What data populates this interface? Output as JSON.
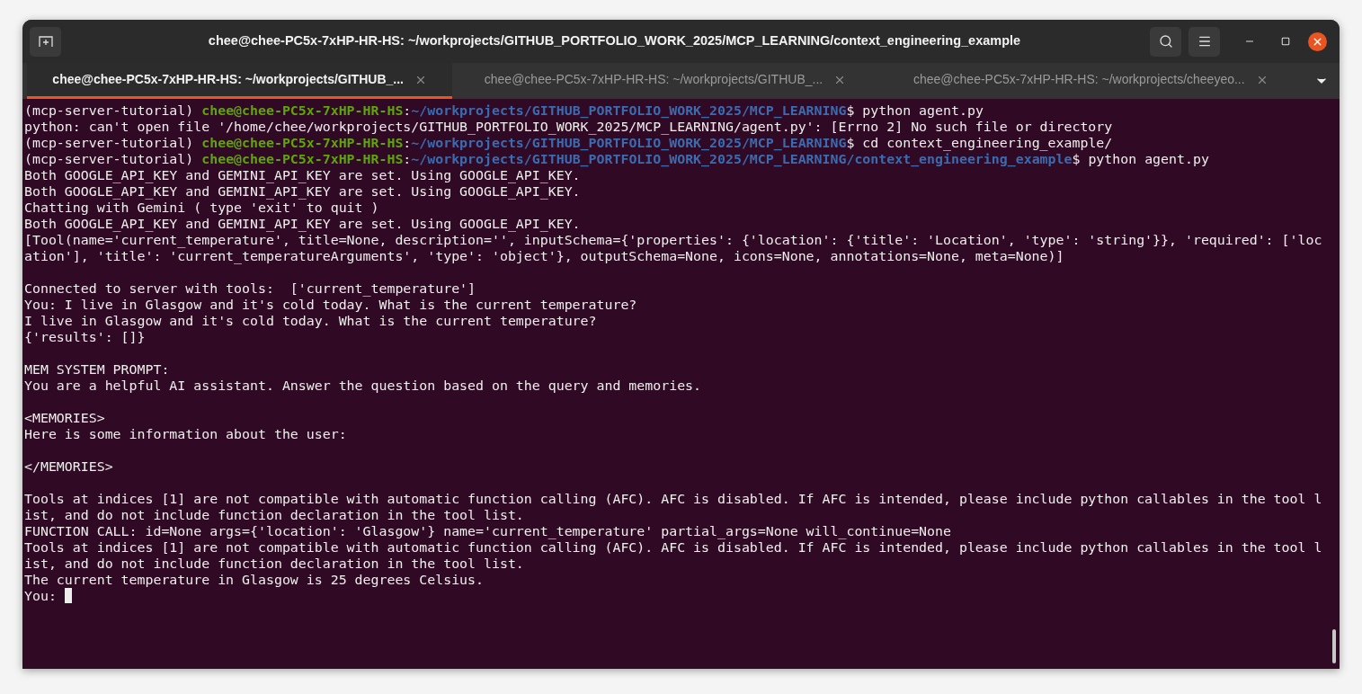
{
  "window": {
    "title": "chee@chee-PC5x-7xHP-HR-HS: ~/workprojects/GITHUB_PORTFOLIO_WORK_2025/MCP_LEARNING/context_engineering_example"
  },
  "tabs": [
    {
      "label": "chee@chee-PC5x-7xHP-HR-HS: ~/workprojects/GITHUB_...",
      "selected": true
    },
    {
      "label": "chee@chee-PC5x-7xHP-HR-HS: ~/workprojects/GITHUB_...",
      "selected": false
    },
    {
      "label": "chee@chee-PC5x-7xHP-HR-HS: ~/workprojects/cheeyeo...",
      "selected": false
    }
  ],
  "terminal": {
    "lines": [
      {
        "kind": "prompt",
        "segments": [
          {
            "kind": "text",
            "text": "(mcp-server-tutorial) "
          },
          {
            "kind": "user",
            "text": "chee@chee-PC5x-7xHP-HR-HS"
          },
          {
            "kind": "text",
            "text": ":"
          },
          {
            "kind": "path",
            "text": "~/workprojects/GITHUB_PORTFOLIO_WORK_2025/MCP_LEARNING"
          },
          {
            "kind": "text",
            "text": "$ python agent.py"
          }
        ]
      },
      {
        "kind": "output",
        "segments": [
          {
            "kind": "text",
            "text": "python: can't open file '/home/chee/workprojects/GITHUB_PORTFOLIO_WORK_2025/MCP_LEARNING/agent.py': [Errno 2] No such file or directory"
          }
        ]
      },
      {
        "kind": "prompt",
        "segments": [
          {
            "kind": "text",
            "text": "(mcp-server-tutorial) "
          },
          {
            "kind": "user",
            "text": "chee@chee-PC5x-7xHP-HR-HS"
          },
          {
            "kind": "text",
            "text": ":"
          },
          {
            "kind": "path",
            "text": "~/workprojects/GITHUB_PORTFOLIO_WORK_2025/MCP_LEARNING"
          },
          {
            "kind": "text",
            "text": "$ cd context_engineering_example/"
          }
        ]
      },
      {
        "kind": "prompt",
        "segments": [
          {
            "kind": "text",
            "text": "(mcp-server-tutorial) "
          },
          {
            "kind": "user",
            "text": "chee@chee-PC5x-7xHP-HR-HS"
          },
          {
            "kind": "text",
            "text": ":"
          },
          {
            "kind": "path",
            "text": "~/workprojects/GITHUB_PORTFOLIO_WORK_2025/MCP_LEARNING/context_engineering_example"
          },
          {
            "kind": "text",
            "text": "$ python agent.py"
          }
        ]
      },
      {
        "kind": "output",
        "segments": [
          {
            "kind": "text",
            "text": "Both GOOGLE_API_KEY and GEMINI_API_KEY are set. Using GOOGLE_API_KEY."
          }
        ]
      },
      {
        "kind": "output",
        "segments": [
          {
            "kind": "text",
            "text": "Both GOOGLE_API_KEY and GEMINI_API_KEY are set. Using GOOGLE_API_KEY."
          }
        ]
      },
      {
        "kind": "output",
        "segments": [
          {
            "kind": "text",
            "text": "Chatting with Gemini ( type 'exit' to quit )"
          }
        ]
      },
      {
        "kind": "output",
        "segments": [
          {
            "kind": "text",
            "text": "Both GOOGLE_API_KEY and GEMINI_API_KEY are set. Using GOOGLE_API_KEY."
          }
        ]
      },
      {
        "kind": "output",
        "segments": [
          {
            "kind": "text",
            "text": "[Tool(name='current_temperature', title=None, description='', inputSchema={'properties': {'location': {'title': 'Location', 'type': 'string'}}, 'required': ['loc"
          }
        ]
      },
      {
        "kind": "output",
        "segments": [
          {
            "kind": "text",
            "text": "ation'], 'title': 'current_temperatureArguments', 'type': 'object'}, outputSchema=None, icons=None, annotations=None, meta=None)]"
          }
        ]
      },
      {
        "kind": "blank"
      },
      {
        "kind": "output",
        "segments": [
          {
            "kind": "text",
            "text": "Connected to server with tools:  ['current_temperature']"
          }
        ]
      },
      {
        "kind": "output",
        "segments": [
          {
            "kind": "text",
            "text": "You: I live in Glasgow and it's cold today. What is the current temperature?"
          }
        ]
      },
      {
        "kind": "output",
        "segments": [
          {
            "kind": "text",
            "text": "I live in Glasgow and it's cold today. What is the current temperature?"
          }
        ]
      },
      {
        "kind": "output",
        "segments": [
          {
            "kind": "text",
            "text": "{'results': []}"
          }
        ]
      },
      {
        "kind": "blank"
      },
      {
        "kind": "output",
        "segments": [
          {
            "kind": "text",
            "text": "MEM SYSTEM PROMPT:"
          }
        ]
      },
      {
        "kind": "output",
        "segments": [
          {
            "kind": "text",
            "text": "You are a helpful AI assistant. Answer the question based on the query and memories."
          }
        ]
      },
      {
        "kind": "blank"
      },
      {
        "kind": "output",
        "segments": [
          {
            "kind": "text",
            "text": "<MEMORIES>"
          }
        ]
      },
      {
        "kind": "output",
        "segments": [
          {
            "kind": "text",
            "text": "Here is some information about the user:"
          }
        ]
      },
      {
        "kind": "blank"
      },
      {
        "kind": "output",
        "segments": [
          {
            "kind": "text",
            "text": "</MEMORIES>"
          }
        ]
      },
      {
        "kind": "blank"
      },
      {
        "kind": "output",
        "segments": [
          {
            "kind": "text",
            "text": "Tools at indices [1] are not compatible with automatic function calling (AFC). AFC is disabled. If AFC is intended, please include python callables in the tool l"
          }
        ]
      },
      {
        "kind": "output",
        "segments": [
          {
            "kind": "text",
            "text": "ist, and do not include function declaration in the tool list."
          }
        ]
      },
      {
        "kind": "output",
        "segments": [
          {
            "kind": "text",
            "text": "FUNCTION CALL: id=None args={'location': 'Glasgow'} name='current_temperature' partial_args=None will_continue=None"
          }
        ]
      },
      {
        "kind": "output",
        "segments": [
          {
            "kind": "text",
            "text": "Tools at indices [1] are not compatible with automatic function calling (AFC). AFC is disabled. If AFC is intended, please include python callables in the tool l"
          }
        ]
      },
      {
        "kind": "output",
        "segments": [
          {
            "kind": "text",
            "text": "ist, and do not include function declaration in the tool list."
          }
        ]
      },
      {
        "kind": "output",
        "segments": [
          {
            "kind": "text",
            "text": "The current temperature in Glasgow is 25 degrees Celsius."
          }
        ]
      },
      {
        "kind": "input",
        "cursor": true,
        "segments": [
          {
            "kind": "text",
            "text": "You: "
          }
        ]
      }
    ]
  }
}
